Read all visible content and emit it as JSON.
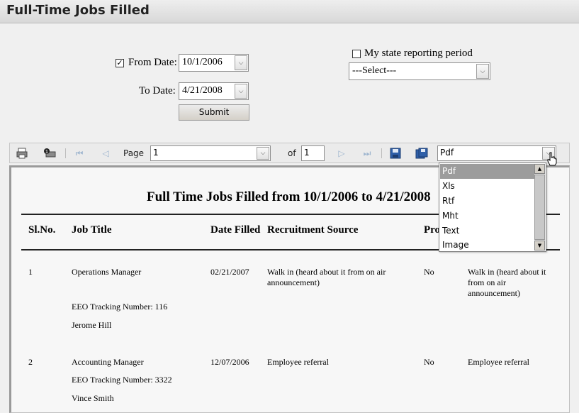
{
  "header": {
    "title": "Full-Time Jobs Filled"
  },
  "filters": {
    "from_date_label": "From Date:",
    "from_date_checked": true,
    "from_date_value": "10/1/2006",
    "to_date_label": "To Date:",
    "to_date_value": "4/21/2008",
    "submit_label": "Submit",
    "state_period_label": "My state reporting period",
    "state_period_checked": false,
    "state_period_select": "---Select---"
  },
  "toolbar": {
    "page_label": "Page",
    "page_value": "1",
    "of_label": "of",
    "total_pages": "1",
    "export_format": "Pdf",
    "icons": [
      "print-icon",
      "print-preview-icon",
      "first-page-icon",
      "prev-page-icon",
      "next-page-icon",
      "last-page-icon",
      "save-icon",
      "export-icon"
    ]
  },
  "export_dropdown": {
    "options": [
      "Pdf",
      "Xls",
      "Rtf",
      "Mht",
      "Text",
      "Image"
    ],
    "selected": "Pdf"
  },
  "report": {
    "title": "Full Time Jobs Filled from 10/1/2006 to 4/21/2008",
    "columns": [
      "Sl.No.",
      "Job Title",
      "Date Filled",
      "Recruitment Source",
      "Pro"
    ],
    "rows": [
      {
        "sl": "1",
        "job_title": "Operations Manager",
        "eeo": "EEO Tracking Number: 116",
        "person": "Jerome Hill",
        "date_filled": "02/21/2007",
        "recruitment_source": "Walk in (heard about it from on air announcement)",
        "pro": "No",
        "extra": "Walk in (heard about it from on air announcement)"
      },
      {
        "sl": "2",
        "job_title": "Accounting Manager",
        "eeo": "EEO Tracking Number: 3322",
        "person": "Vince Smith",
        "date_filled": "12/07/2006",
        "recruitment_source": "Employee referral",
        "pro": "No",
        "extra": "Employee referral"
      }
    ]
  }
}
